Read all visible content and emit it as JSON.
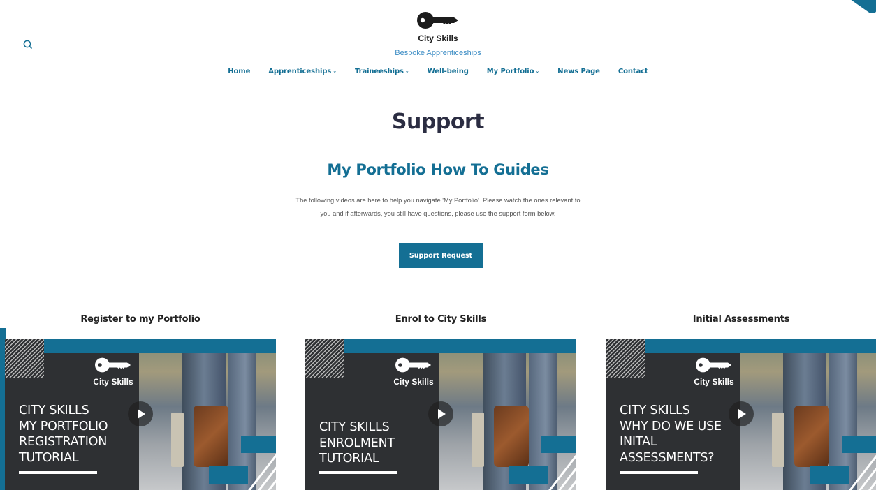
{
  "brand": {
    "name": "City Skills",
    "tagline": "Bespoke Apprenticeships"
  },
  "nav": [
    {
      "label": "Home",
      "has_dropdown": false
    },
    {
      "label": "Apprenticeships",
      "has_dropdown": true
    },
    {
      "label": "Traineeships",
      "has_dropdown": true
    },
    {
      "label": "Well-being",
      "has_dropdown": false
    },
    {
      "label": "My Portfolio",
      "has_dropdown": true
    },
    {
      "label": "News Page",
      "has_dropdown": false
    },
    {
      "label": "Contact",
      "has_dropdown": false
    }
  ],
  "page": {
    "title": "Support",
    "section_title": "My Portfolio How To Guides",
    "intro": "The following videos are here to help you navigate 'My Portfolio'. Please watch the ones relevant to you and if afterwards, you still have questions, please use the support form below.",
    "button_label": "Support Request"
  },
  "videos": [
    {
      "heading": "Register to my Portfolio",
      "thumb_brand": "City Skills",
      "lines": [
        "CITY SKILLS",
        "MY PORTFOLIO",
        "REGISTRATION",
        "TUTORIAL"
      ]
    },
    {
      "heading": "Enrol to City Skills",
      "thumb_brand": "City Skills",
      "lines": [
        "CITY SKILLS",
        "ENROLMENT",
        "TUTORIAL"
      ]
    },
    {
      "heading": "Initial Assessments",
      "thumb_brand": "City Skills",
      "lines": [
        "CITY SKILLS",
        "WHY DO WE USE",
        "INITAL",
        "ASSESSMENTS?"
      ]
    }
  ],
  "icons": {
    "search": "search-icon",
    "logo": "key-icon",
    "play": "play-icon",
    "dropdown": "chevron-down-icon"
  },
  "colors": {
    "accent": "#146f94",
    "heading": "#2b2d42",
    "tagline": "#3b8cc4",
    "thumb_bg": "#2e3033"
  }
}
